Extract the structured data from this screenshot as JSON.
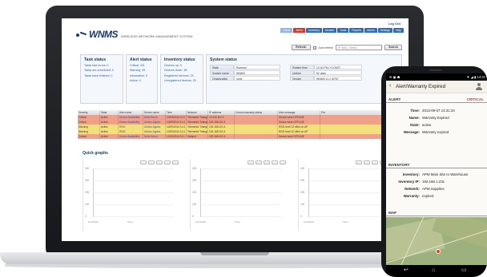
{
  "app": {
    "logo": "WNMS",
    "subtitle": "WIRELESS NETWORK MANAGEMENT SYSTEM",
    "logout": "Log Out",
    "nav_tabs": [
      {
        "label": "Home",
        "state": "active"
      },
      {
        "label": "Alerts",
        "state": "alert"
      },
      {
        "label": "Inventory",
        "state": "normal"
      },
      {
        "label": "Monitor",
        "state": "normal"
      },
      {
        "label": "Tools",
        "state": "normal"
      },
      {
        "label": "Reports",
        "state": "normal"
      },
      {
        "label": "Admin",
        "state": "normal"
      },
      {
        "label": "Settings",
        "state": "normal"
      },
      {
        "label": "Help",
        "state": "normal"
      }
    ]
  },
  "toolbar": {
    "refresh_label": "Refresh",
    "auto_refresh_label": "Auto refresh",
    "search_placeholder": "IP, MAC, Serial...",
    "search_label": "Search"
  },
  "task_status": {
    "title": "Task status",
    "lines": [
      "Tasks had errors: 0",
      "Tasks are scheduled: 0",
      "Tasks have finished: 0"
    ]
  },
  "alert_status": {
    "title": "Alert status",
    "lines": [
      "Critical: 411",
      "Warning: 49",
      "Information: 0",
      "Active: 4"
    ]
  },
  "inventory_status": {
    "title": "Inventory status",
    "lines": [
      "Devices up: 5",
      "Devices down: 38",
      "Registered devices: 23",
      "Unregistered devices: 20"
    ]
  },
  "system_status": {
    "title": "System status",
    "rows": [
      {
        "k1": "State",
        "v1": "Running",
        "k2": "System time",
        "v2": "12:00 PM (+0 GMT)"
      },
      {
        "k1": "System name",
        "v1": "WNMS",
        "k2": "Uptime",
        "v2": "52 days"
      },
      {
        "k1": "Organization",
        "v1": "none",
        "k2": "Version",
        "v2": "WNMS v1.2 r6767"
      }
    ]
  },
  "alerts_grid": {
    "headers": [
      "Severity",
      "State",
      "Alert name",
      "Device name",
      "Time",
      "Network",
      "IP address",
      "Current warranty status",
      "Alert message",
      "Pre"
    ],
    "rows": [
      {
        "color": "#f0a08a",
        "cells": [
          "Critical",
          "Active",
          "Device Availability",
          "Dells Heron",
          "10/09/2014 11:2",
          "Telemedix Triangle",
          "10.100.102.2",
          "",
          "Device went OFFLINE",
          ""
        ]
      },
      {
        "color": "#f0a08a",
        "cells": [
          "Critical",
          "Active",
          "Device Availability",
          "Ulchiro Apples",
          "10/09/2014 11:4",
          "Telemedix Triangle",
          "192.168.101.4",
          "",
          "Device went OFFLINE",
          ""
        ]
      },
      {
        "color": "#f3e07a",
        "cells": [
          "Warning",
          "Active",
          "RSSI",
          "Ulchiro Apples",
          "10/09/2014 11:4",
          "Telemedix Triangle",
          "192.168.101.4",
          "",
          "RSSI level 10 dBm on AP",
          ""
        ]
      },
      {
        "color": "#f3e07a",
        "cells": [
          "Warning",
          "Active",
          "RSSI",
          "Ulchiro Apples",
          "10/09/2014 11:4",
          "Telemedix Triangle",
          "192.168.101.4",
          "",
          "RSSI level 10 dBm on AP",
          ""
        ]
      },
      {
        "color": "#f0a08a",
        "cells": [
          "Critical",
          "Active",
          "Device Availability",
          "Dells Heron",
          "10/10/2014 11:1",
          "Hotspot",
          "192.168.101.4",
          "",
          "Device went OFFLINE",
          ""
        ]
      }
    ]
  },
  "quick_graphs": {
    "title": "Quick graphs",
    "graphs": [
      {
        "yticks": [
          "400",
          "300",
          "200",
          "100",
          "0"
        ],
        "date": "12:00 AM",
        "xlabel": "Time"
      },
      {
        "yticks": [
          "400",
          "300",
          "200",
          "100",
          "0"
        ],
        "date": "12:00 AM",
        "xlabel": "Time"
      },
      {
        "yticks": [
          "400",
          "300",
          "200",
          "100",
          "0"
        ],
        "date": "12:00 AM",
        "xlabel": "Time"
      }
    ]
  },
  "phone": {
    "status_time": "14:21",
    "status_icons": "▼ ◢ ▮",
    "title": "Alert/Warranty Expired",
    "alert_section": "ALERT",
    "severity": "CRITICAL",
    "alert_fields": [
      {
        "key": "Time:",
        "value": "2013-08-07 14:31:34"
      },
      {
        "key": "Name:",
        "value": "Warranty Expired"
      },
      {
        "key": "State:",
        "value": "active"
      },
      {
        "key": "Message:",
        "value": "Warranty expired"
      }
    ],
    "inventory_section": "INVENTORY",
    "inventory_fields": [
      {
        "key": "Inventory:",
        "value": "APM Main Site to Warehouse"
      },
      {
        "key": "Inventory IP:",
        "value": "192.168.1.231"
      },
      {
        "key": "Network:",
        "value": "APM.Supplies"
      },
      {
        "key": "Warranty:",
        "value": "expired"
      }
    ],
    "map_section": "MAP"
  },
  "colors": {
    "brand": "#1b3a66",
    "nav": "#2f6db5",
    "critical": "#f0a08a",
    "warning": "#f3e07a"
  }
}
